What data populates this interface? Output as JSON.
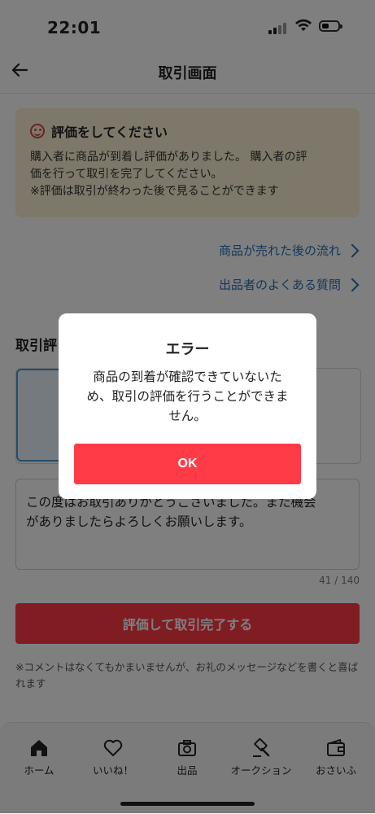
{
  "status_bar": {
    "time": "22:01"
  },
  "header": {
    "title": "取引画面"
  },
  "notice": {
    "title": "評価をしてください",
    "body_line1": "購入者に商品が到着し評価がありました。 購入者の評",
    "body_line2": "価を行って取引を完了してください。",
    "body_line3": "※評価は取引が終わった後で見ることができます"
  },
  "links": {
    "flow": "商品が売れた後の流れ",
    "faq": "出品者のよくある質問"
  },
  "rating": {
    "section_title": "取引評",
    "comment_line1": "この度はお取引ありがとうございました。また機会",
    "comment_line2": "がありましたらよろしくお願いします。",
    "counter": "41 / 140",
    "submit_label": "評価して取引完了する",
    "note": "※コメントはなくてもかまいませんが、お礼のメッセージなどを書くと喜ばれます"
  },
  "tabbar": {
    "items": [
      {
        "label": "ホーム",
        "icon": "home-icon"
      },
      {
        "label": "いいね！",
        "icon": "heart-icon"
      },
      {
        "label": "出品",
        "icon": "camera-icon"
      },
      {
        "label": "オークション",
        "icon": "gavel-icon"
      },
      {
        "label": "おさいふ",
        "icon": "wallet-icon"
      }
    ]
  },
  "dialog": {
    "title": "エラー",
    "message": "商品の到着が確認できていないため、取引の評価を行うことができません。",
    "ok_label": "OK"
  },
  "colors": {
    "accent": "#ff3b47",
    "link": "#2a6fb5",
    "notice_bg": "#faf1d3"
  }
}
